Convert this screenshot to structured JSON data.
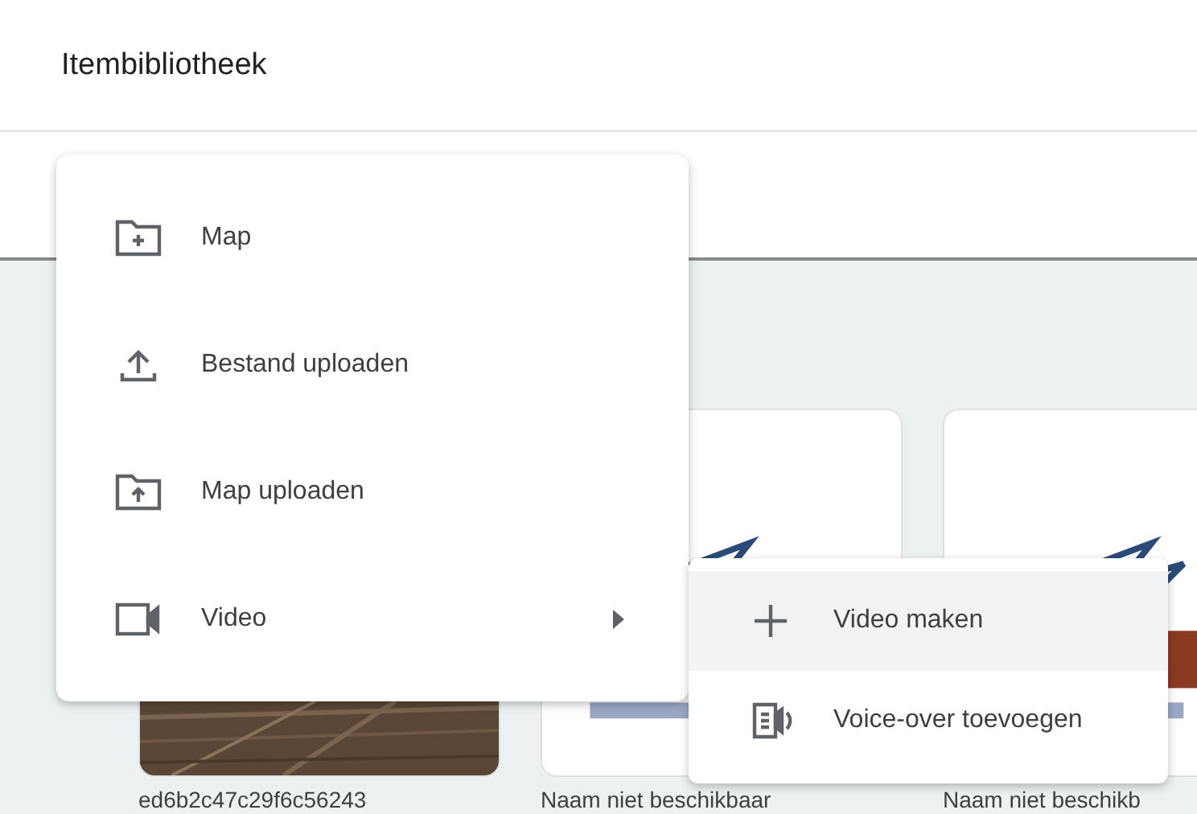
{
  "header": {
    "title": "Itembibliotheek"
  },
  "cards": [
    {
      "caption": "ed6b2c47c29f6c56243",
      "kind": "wood"
    },
    {
      "caption": "Naam niet beschikbaar",
      "kind": "logo"
    },
    {
      "caption": "Naam niet beschikb",
      "kind": "logo"
    }
  ],
  "menu": {
    "items": [
      {
        "label": "Map",
        "kind": "folder-plus"
      },
      {
        "label": "Bestand uploaden",
        "kind": "upload"
      },
      {
        "label": "Map uploaden",
        "kind": "folder-upload"
      },
      {
        "label": "Video",
        "kind": "video",
        "submenu": true
      }
    ]
  },
  "submenu": {
    "items": [
      {
        "label": "Video maken",
        "kind": "plus",
        "selected": true
      },
      {
        "label": "Voice-over toevoegen",
        "kind": "voice",
        "selected": false
      }
    ]
  }
}
